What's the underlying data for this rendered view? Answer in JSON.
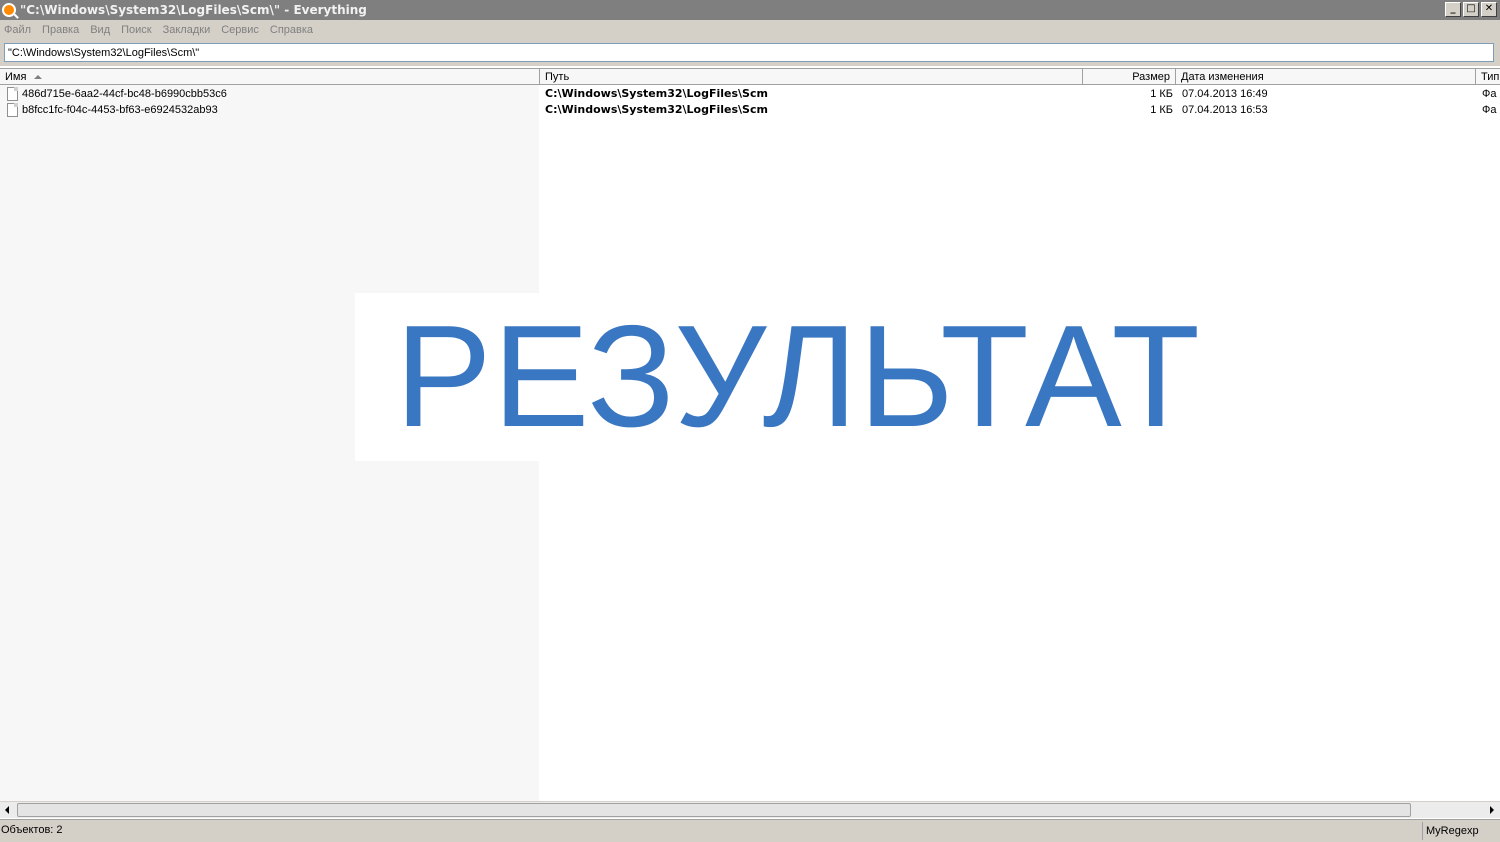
{
  "window": {
    "title": "\"C:\\Windows\\System32\\LogFiles\\Scm\\\" - Everything",
    "minimize": "_",
    "maximize": "□",
    "close": "✕"
  },
  "menu": {
    "items": [
      "Файл",
      "Правка",
      "Вид",
      "Поиск",
      "Закладки",
      "Сервис",
      "Справка"
    ]
  },
  "search": {
    "value": "\"C:\\Windows\\System32\\LogFiles\\Scm\\\""
  },
  "columns": {
    "name": "Имя",
    "path": "Путь",
    "size": "Размер",
    "modified": "Дата изменения",
    "type": "Тип"
  },
  "rows": [
    {
      "name": "486d715e-6aa2-44cf-bc48-b6990cbb53c6",
      "path": "C:\\Windows\\System32\\LogFiles\\Scm",
      "size": "1 КБ",
      "modified": "07.04.2013 16:49",
      "type": "Фа"
    },
    {
      "name": "b8fcc1fc-f04c-4453-bf63-e6924532ab93",
      "path": "C:\\Windows\\System32\\LogFiles\\Scm",
      "size": "1 КБ",
      "modified": "07.04.2013 16:53",
      "type": "Фа"
    }
  ],
  "overlay": {
    "text": "РЕЗУЛЬТАТ",
    "color": "#3a77c2"
  },
  "status": {
    "left": "Объектов: 2",
    "right": "MyRegexp"
  },
  "icons": {
    "app": "everything-search-icon",
    "file": "file-icon",
    "sort": "sort-ascending-icon"
  }
}
